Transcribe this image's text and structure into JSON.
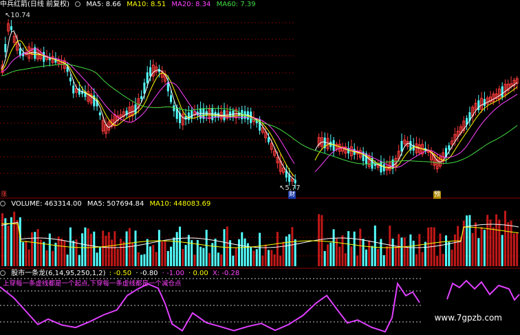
{
  "price_panel": {
    "title": "中兵红箭(日线 前复权)",
    "ma": [
      {
        "label": "MA5: 8.66",
        "color": "#ffffff"
      },
      {
        "label": "MA10: 8.51",
        "color": "#ffff00"
      },
      {
        "label": "MA20: 8.34",
        "color": "#ff44ff"
      },
      {
        "label": "MA60: 7.39",
        "color": "#44dd44"
      }
    ],
    "high_label": "10.74",
    "low_label": "5.77",
    "left_mark": "涨",
    "event_marks": [
      "财",
      "预"
    ]
  },
  "volume_panel": {
    "label": "VOLUME: 463314.00",
    "ma5": "MA5: 507694.84",
    "ma10": "MA10: 448083.69",
    "label_color": "#ffffff",
    "ma5_color": "#ffffff",
    "ma10_color": "#ffff00"
  },
  "indicator_panel": {
    "title": "股市一条龙(6,14,95,250,1,2)",
    "values": [
      {
        "label": ": -0.50",
        "color": "#ffff00"
      },
      {
        "label": "· -0.80",
        "color": "#ffffff"
      },
      {
        "label": "· -1.00",
        "color": "#ff44ff"
      },
      {
        "label": "· 0.00",
        "color": "#ffff00"
      },
      {
        "label": "X: -0.28",
        "color": "#ff44ff"
      }
    ],
    "note": "上穿每一条虚线都是一个起点,下穿每一条虚线都是一个减仓点",
    "note_color": "#ff44ff"
  },
  "watermark": "www.7gpzb.com",
  "colors": {
    "up": "#ff3c3c",
    "down": "#54ffff",
    "grid": "#7a0000",
    "osc": "#e040ff"
  }
}
